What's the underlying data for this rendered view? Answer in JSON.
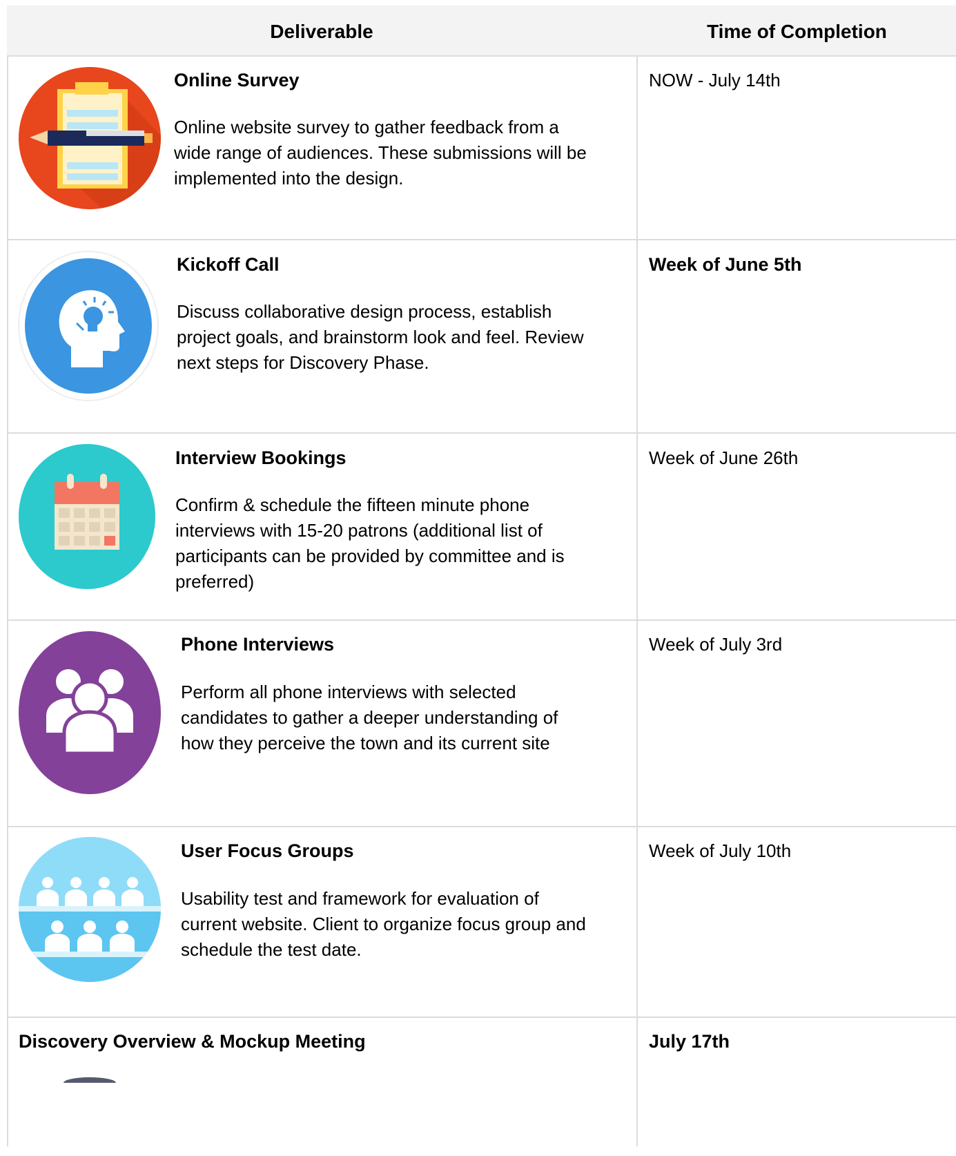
{
  "header": {
    "deliverable": "Deliverable",
    "time": "Time of Completion"
  },
  "rows": [
    {
      "title": "Online Survey",
      "description": "Online website survey to gather feedback from a wide range of audiences. These submissions will be implemented into the design.",
      "time": "NOW - July 14th",
      "icon": "clipboard-survey-icon",
      "color": "#e8461d"
    },
    {
      "title": "Kickoff Call",
      "description": "Discuss collaborative design process, establish project goals, and brainstorm look and feel. Review next steps for Discovery Phase.",
      "time": "Week of June 5th",
      "icon": "idea-head-icon",
      "color": "#3b95e0"
    },
    {
      "title": "Interview Bookings",
      "description": "Confirm & schedule the fifteen minute phone interviews with 15-20 patrons (additional list of participants can be provided by committee and is preferred)",
      "time": "Week of June 26th",
      "icon": "calendar-icon",
      "color": "#2cc9cd"
    },
    {
      "title": "Phone Interviews",
      "description": "Perform all phone interviews with selected candidates to gather a deeper understanding of how they perceive the town and its current site",
      "time": "Week of July 3rd",
      "icon": "people-group-icon",
      "color": "#834199"
    },
    {
      "title": "User Focus Groups",
      "description": "Usability test and framework for evaluation of current website. Client to organize focus group and schedule the test date.",
      "time": "Week of July 10th",
      "icon": "audience-icon",
      "color": "#5cc5f0"
    },
    {
      "title": "Discovery Overview & Mockup Meeting",
      "time": "July 17th"
    }
  ]
}
